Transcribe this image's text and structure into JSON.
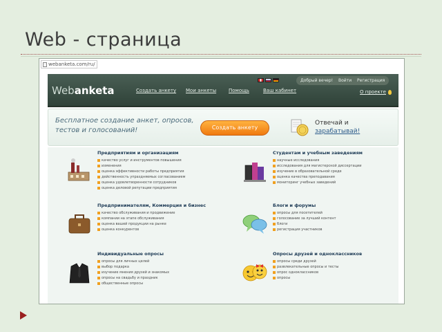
{
  "slide": {
    "title": "Web - страница"
  },
  "browser": {
    "address": "webanketa.com/ru/"
  },
  "header": {
    "logo_light": "Web",
    "logo_bold": "anketa",
    "nav": [
      "Создать анкету",
      "Мои анкеты",
      "Помощь",
      "Ваш кабинет"
    ],
    "login": {
      "greeting": "Добрый вечер!",
      "sign_in": "Войти",
      "register": "Регистрация"
    },
    "about": "О проекте"
  },
  "banner": {
    "tagline": "Бесплатное создание анкет, опросов, тестов и голосований!",
    "cta": "Создать анкету",
    "earn_line1": "Отвечай и",
    "earn_line2": "зарабатывай!"
  },
  "sections": [
    {
      "title": "Предприятиям и организациям",
      "items": [
        "качество услуг и инструментов повышения",
        "изменения",
        "оценка эффективности работы предприятия",
        "действенность упраздняемых согласованием",
        "оценка удовлетворенности сотрудников",
        "оценка деловой репутации предприятия"
      ]
    },
    {
      "title": "Студентам и учебным заведениям",
      "items": [
        "научные исследования",
        "исследования для магистерской диссертации",
        "изучение в образовательной среде",
        "оценка качества преподавания",
        "мониторинг учебных заведений"
      ]
    },
    {
      "title": "Предпринимателям, Коммерция и бизнес",
      "items": [
        "качество обслуживания и продвижение",
        "компании на этапе обслуживания",
        "оценка вашей продукции на рынке",
        "оценка конкурентов"
      ]
    },
    {
      "title": "Блоги и форумы",
      "items": [
        "опросы для посетителей",
        "голосование за лучший контент",
        "блоги",
        "регистрация участников"
      ]
    },
    {
      "title": "Индивидуальные опросы",
      "items": [
        "опросы для личных целей",
        "выбор подарка",
        "изучение мнения друзей и знакомых",
        "опросы на свадьбу и праздник",
        "общественные опросы"
      ]
    },
    {
      "title": "Опросы друзей и одноклассников",
      "items": [
        "опросы среди друзей",
        "развлекательные опросы и тесты",
        "опрос одноклассников",
        "опросы"
      ]
    }
  ],
  "colors": {
    "slide_bg": "#e4eee0",
    "header_bg": "#3b4d43",
    "cta": "#f58a1a",
    "section_title": "#1d3a55",
    "bullet": "#f0a020"
  }
}
